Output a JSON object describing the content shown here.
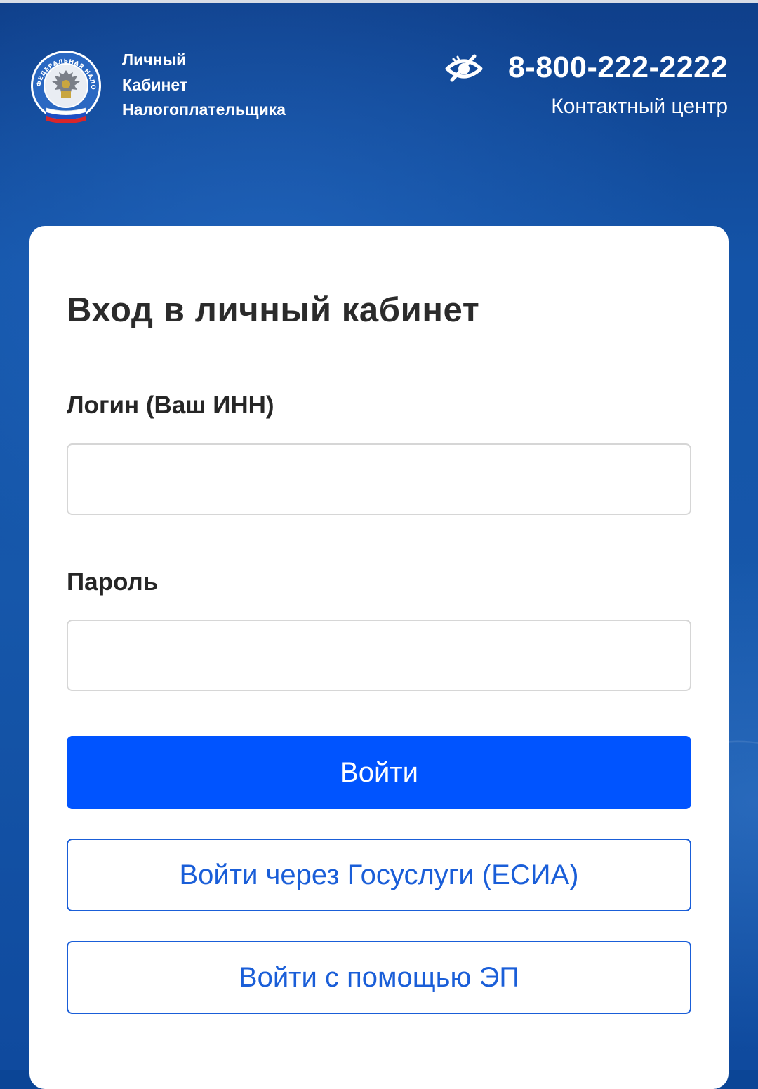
{
  "header": {
    "brand_lines": [
      "Личный",
      "Кабинет",
      "Налогоплательщика"
    ],
    "phone": "8-800-222-2222",
    "contact_label": "Контактный центр",
    "accessibility_icon": "eye-slash-icon",
    "logo_icon": "fns-emblem-icon"
  },
  "login_form": {
    "title": "Вход в личный кабинет",
    "login_label": "Логин (Ваш ИНН)",
    "login_value": "",
    "password_label": "Пароль",
    "password_value": "",
    "submit_label": "Войти",
    "esia_label": "Войти через Госуслуги (ЕСИА)",
    "ep_label": "Войти с помощью ЭП"
  },
  "colors": {
    "background": "#1657aa",
    "primary_button": "#0054ff",
    "outline_button": "#1a5ed8",
    "card": "#ffffff",
    "text_dark": "#2b2b2b"
  }
}
